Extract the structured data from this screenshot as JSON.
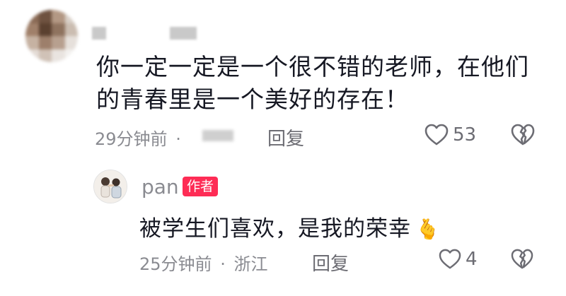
{
  "comment": {
    "text": "你一定一定是一个很不错的老师，在他们的青春里是一个美好的存在！",
    "time": "29分钟前",
    "dot": "·",
    "reply_label": "回复",
    "like_count": "53"
  },
  "reply": {
    "user": "pan",
    "author_badge": "作者",
    "text": "被学生们喜欢，是我的荣幸",
    "emoji": "🫰",
    "time": "25分钟前",
    "dot": "·",
    "location": "浙江",
    "reply_label": "回复",
    "like_count": "4"
  },
  "colors": {
    "text": "#161823",
    "secondary": "#8a8b91",
    "badge": "#fe2c55"
  },
  "icons": [
    "heart-outline-icon",
    "broken-heart-icon",
    "heart-hand-emoji"
  ]
}
